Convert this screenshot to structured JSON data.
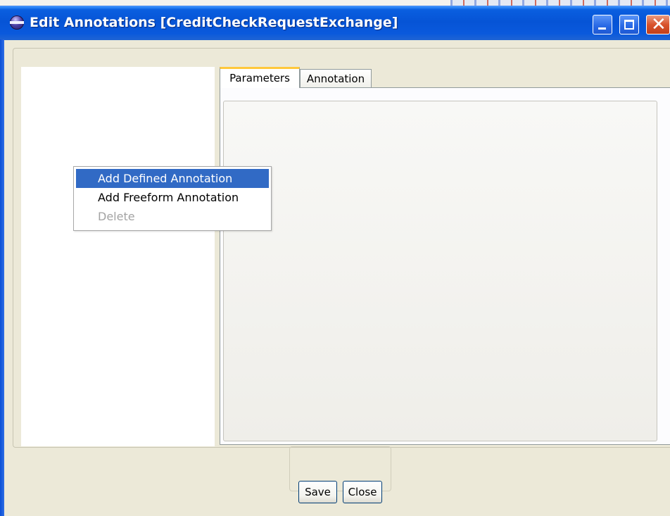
{
  "window": {
    "title": "Edit Annotations [CreditCheckRequestExchange]",
    "controls": {
      "minimize": "minimize-icon",
      "maximize": "maximize-icon",
      "close_glyph": "✕"
    }
  },
  "tabs": [
    {
      "label": "Parameters",
      "active": true
    },
    {
      "label": "Annotation",
      "active": false
    }
  ],
  "context_menu": {
    "items": [
      {
        "label": "Add Defined Annotation",
        "state": "selected"
      },
      {
        "label": "Add Freeform Annotation",
        "state": "normal"
      },
      {
        "label": "Delete",
        "state": "disabled"
      }
    ]
  },
  "buttons": {
    "save": "Save",
    "close": "Close"
  },
  "colors": {
    "title_bar": "#0654d6",
    "menu_selection": "#316ac5",
    "active_tab_highlight": "#ffc83c",
    "dialog_background": "#ece9d8"
  }
}
